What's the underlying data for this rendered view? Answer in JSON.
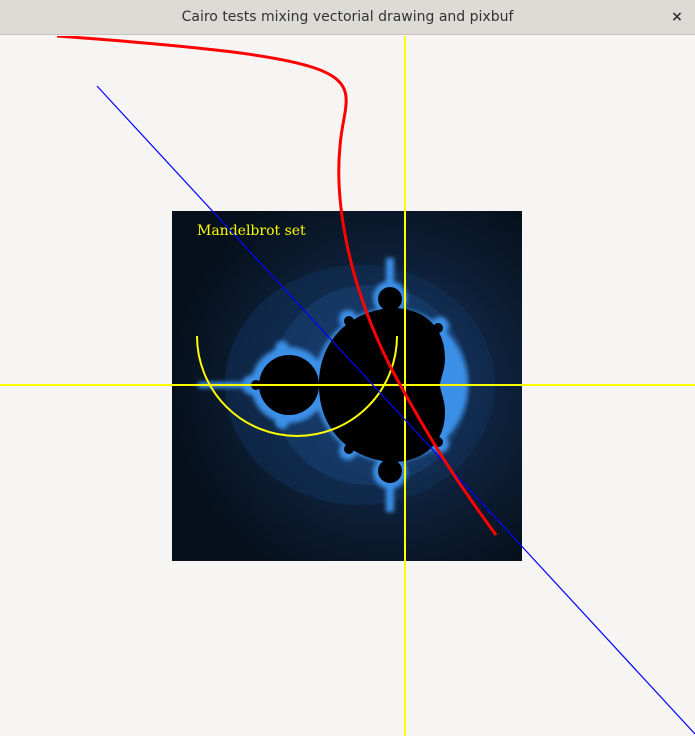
{
  "window": {
    "title": "Cairo tests mixing vectorial drawing and pixbuf",
    "close_glyph": "×"
  },
  "drawing": {
    "fractal_label": "Mandelbrot set",
    "colors": {
      "background": "#f6f5f4",
      "fractal_bg": "#050b14",
      "fractal_set": "#000000",
      "fractal_edge": "#2e7fd8",
      "axes": "#ffff00",
      "arc": "#ffff00",
      "diagonal": "#0000ff",
      "curve": "#ff0000",
      "label": "#ffff00"
    }
  }
}
